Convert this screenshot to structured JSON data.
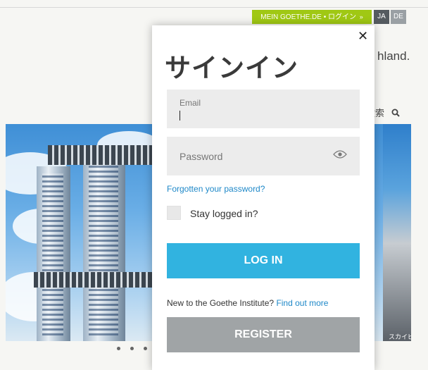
{
  "topbar": {
    "mein_label": "MEIN GOETHE.DE • ログイン",
    "chevron": "»",
    "lang_ja": "JA",
    "lang_de": "DE"
  },
  "background": {
    "tagline_fragment": "hland.",
    "search_label": "検索",
    "search_icon": "search-icon",
    "hero_caption": "スカイビル"
  },
  "modal": {
    "title": "サインイン",
    "close_icon": "close-icon",
    "email": {
      "label": "Email",
      "value": ""
    },
    "password": {
      "placeholder": "Password",
      "icon": "eye-icon"
    },
    "forgot_link": "Forgotten your password?",
    "stay_label": "Stay logged in?",
    "login_button": "LOG IN",
    "new_text": "New to the Goethe Institute?",
    "find_out_link": "Find out more",
    "register_button": "REGISTER"
  },
  "colors": {
    "mein_bar": "#a0c814",
    "login_button": "#31b3e0",
    "register_button": "#a0a4a6",
    "link": "#1e88c8"
  }
}
